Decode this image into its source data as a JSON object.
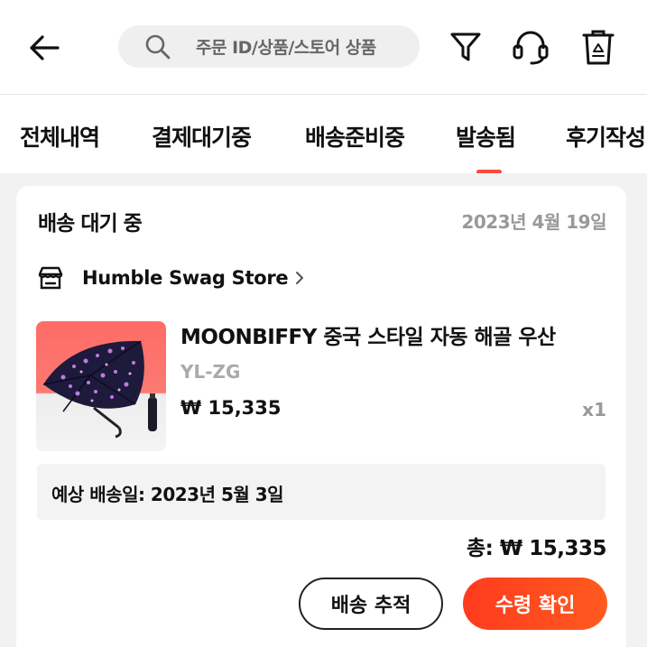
{
  "search": {
    "text": "주문 ID/상품/스토어 상품"
  },
  "icons": {
    "back": "arrow-left",
    "search": "magnifier",
    "filter": "funnel",
    "support": "headset",
    "trash": "trash-can"
  },
  "tabs": [
    {
      "label": "전체내역",
      "active": false
    },
    {
      "label": "결제대기중",
      "active": false
    },
    {
      "label": "배송준비중",
      "active": false
    },
    {
      "label": "발송됨",
      "active": true
    },
    {
      "label": "후기작성"
    }
  ],
  "colors": {
    "accent": "#ff4a3d",
    "confirm_button": "#ff4520"
  },
  "order": {
    "status": "배송 대기 중",
    "date": "2023년 4월 19일",
    "store": "Humble Swag Store",
    "product": {
      "name": "MOONBIFFY 중국 스타일 자동 해골 우산",
      "option": "YL-ZG",
      "price": "₩ 15,335",
      "qty": "x1"
    },
    "eta": "예상 배송일: 2023년 5월 3일",
    "total": "총: ₩ 15,335",
    "buttons": {
      "track": "배송 추적",
      "confirm": "수령 확인"
    }
  }
}
